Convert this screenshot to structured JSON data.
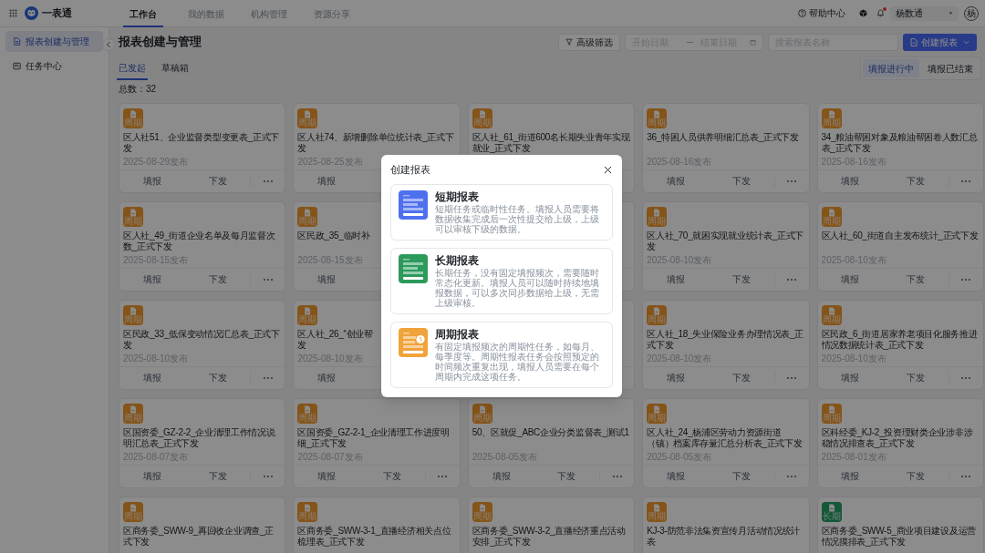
{
  "top_bar": {
    "app_name": "一表通",
    "nav": [
      {
        "label": "工作台",
        "selected": true
      },
      {
        "label": "我的数据",
        "selected": false
      },
      {
        "label": "机构管理",
        "selected": false
      },
      {
        "label": "资源分享",
        "selected": false
      }
    ],
    "help": "帮助中心",
    "notifications": {
      "unread": true
    },
    "user": "杨数通",
    "avatar": "杨"
  },
  "sidebar": {
    "items": [
      {
        "kind": "report",
        "label": "报表创建与管理",
        "selected": true
      },
      {
        "kind": "task",
        "label": "任务中心",
        "selected": false
      }
    ]
  },
  "page": {
    "title": "报表创建与管理",
    "filter_button": "高级筛选",
    "date_range": {
      "start_placeholder": "开始日期",
      "end_placeholder": "结束日期"
    },
    "search": {
      "placeholder": "搜索报表名称"
    },
    "create_button": "创建报表",
    "tabs": [
      {
        "label": "已发起",
        "selected": true
      },
      {
        "label": "草稿箱",
        "selected": false
      }
    ],
    "status_filter": [
      {
        "label": "填报进行中",
        "selected": true
      },
      {
        "label": "填报已结束",
        "selected": false
      }
    ],
    "total": "总数：32",
    "cards": [
      {
        "kind": "periodic",
        "badge": "周期",
        "title": "区人社51、企业监督类型变更表_正式下发",
        "date": "2025-08-29发布",
        "actions": [
          "填报",
          "下发"
        ],
        "more": true
      },
      {
        "kind": "periodic",
        "badge": "周期",
        "title": "区人社74、新增删除单位统计表_正式下发",
        "date": "2025-08-25发布",
        "actions": [
          "填报"
        ]
      },
      {
        "kind": "periodic",
        "badge": "周期",
        "title": "区人社_61_街道600名长期失业青年实现就业_正式下发"
      },
      {
        "kind": "periodic",
        "badge": "周期",
        "title": "36_特困人员供养明细汇总表_正式下发",
        "date": "2025-08-16发布",
        "actions": [
          "填报",
          "下发"
        ],
        "more": true
      },
      {
        "kind": "periodic",
        "badge": "周期",
        "title": "34_粮油帮困对象及粮油帮困卷人数汇总表_正式下发",
        "date": "2025-08-16发布",
        "actions": [
          "填报",
          "下发"
        ],
        "more": true
      },
      {
        "kind": "periodic",
        "badge": "周期",
        "title": "区人社_49_街道企业名单及每月监督次数_正式下发",
        "date": "2025-08-15发布",
        "actions": [
          "填报",
          "下发"
        ],
        "more": true
      },
      {
        "kind": "periodic",
        "badge": "周期",
        "title": "区民政_35_临时补",
        "date": "2025-08-15发布",
        "actions": [
          "填报"
        ]
      },
      {
        "kind": "covered"
      },
      {
        "kind": "periodic",
        "badge": "周期",
        "title": "区人社_70_就困实现就业统计表_正式下发",
        "date": "2025-08-10发布",
        "actions": [
          "填报",
          "下发"
        ],
        "more": true
      },
      {
        "kind": "periodic",
        "badge": "周期",
        "title": "区人社_60_街道自主发布统计_正式下发",
        "date": "2025-08-10发布",
        "actions": [
          "填报",
          "下发"
        ],
        "more": true
      },
      {
        "kind": "periodic",
        "badge": "周期",
        "title": "区民政_33_低保变动情况汇总表_正式下发",
        "date": "2025-08-10发布",
        "actions": [
          "填报",
          "下发"
        ],
        "more": true
      },
      {
        "kind": "periodic",
        "badge": "周期",
        "title_lines": [
          "区人社_26_“创业帮",
          "发"
        ],
        "date": "2025-08-10发布",
        "actions": [
          "填报"
        ]
      },
      {
        "kind": "covered"
      },
      {
        "kind": "periodic",
        "badge": "周期",
        "title": "区人社_18_失业保险业务办理情况表_正式下发",
        "date": "2025-08-10发布",
        "actions": [
          "填报",
          "下发"
        ],
        "more": true
      },
      {
        "kind": "periodic",
        "badge": "周期",
        "title": "区民政_6_街道居家养老项目化服务推进情况数据统计表_正式下发",
        "date": "2025-08-10发布",
        "actions": [
          "填报",
          "下发"
        ],
        "more": true
      },
      {
        "kind": "periodic",
        "badge": "周期",
        "title": "区国资委_GZ-2-2_企业清理工作情况说明汇总表_正式下发",
        "date": "2025-08-07发布",
        "actions": [
          "填报",
          "下发"
        ],
        "more": true
      },
      {
        "kind": "periodic",
        "badge": "周期",
        "title": "区国资委_GZ-2-1_企业清理工作进度明细_正式下发",
        "date": "2025-08-07发布",
        "actions": [
          "填报",
          "下发"
        ],
        "more": true
      },
      {
        "kind": "periodic",
        "badge": "周期",
        "title": "50、区就促_ABC企业分类监督表_测试1",
        "date": "2025-08-05发布",
        "actions": [
          "填报",
          "下发"
        ],
        "more": true
      },
      {
        "kind": "periodic",
        "badge": "周期",
        "title": "区人社_24_杨浦区劳动力资源街道（镇）档案库存量汇总分析表_正式下发",
        "date": "2025-08-05发布",
        "actions": [
          "填报",
          "下发"
        ],
        "more": true
      },
      {
        "kind": "periodic",
        "badge": "周期",
        "title": "区科经委_KJ-2_投资理财类企业涉非涉稳情况排查表_正式下发",
        "date": "2025-08-01发布",
        "actions": [
          "填报",
          "下发"
        ],
        "more": true
      },
      {
        "kind": "periodic",
        "badge": "周期",
        "title": "区商务委_SWW-9_再回收企业调查_正式下发"
      },
      {
        "kind": "periodic",
        "badge": "周期",
        "title": "区商务委_SWW-3-1_直播经济相关点位梳理表_正式下发"
      },
      {
        "kind": "periodic",
        "badge": "周期",
        "title": "区商务委_SWW-3-2_直播经济重点活动安排_正式下发"
      },
      {
        "kind": "periodic",
        "badge": "周期",
        "title": "KJ-3-防范非法集资宣传月活动情况统计表"
      },
      {
        "kind": "long",
        "badge": "长期",
        "title": "区商务委_SWW-5_商业项目建设及运营情况摸排表_正式下发"
      }
    ]
  },
  "dialog": {
    "title": "创建报表",
    "options": [
      {
        "kind": "short",
        "title": "短期报表",
        "description": "短期任务或临时性任务。填报人员需要将数据收集完成后一次性提交给上级，上级可以审核下级的数据。"
      },
      {
        "kind": "long",
        "title": "长期报表",
        "description": "长期任务，没有固定填报频次，需要随时常态化更新。填报人员可以随时持续地填报数据，可以多次同步数据给上级，无需上级审核。"
      },
      {
        "kind": "periodic",
        "title": "周期报表",
        "description": "有固定填报频次的周期性任务，如每月、每季度等。周期性报表任务会按照预定的时间频次重复出现，填报人员需要在每个周期内完成这项任务。"
      }
    ]
  }
}
